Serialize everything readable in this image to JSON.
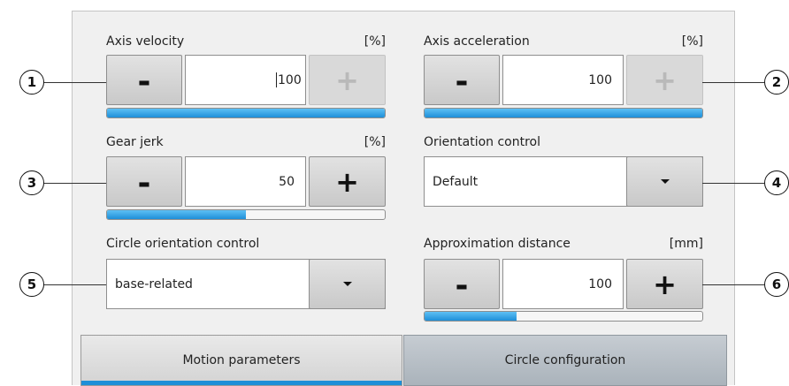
{
  "fields": {
    "axis_velocity": {
      "label": "Axis velocity",
      "unit": "[%]",
      "value": "100",
      "minus": "-",
      "plus": "+",
      "slider_fraction": 1.0
    },
    "axis_acceleration": {
      "label": "Axis acceleration",
      "unit": "[%]",
      "value": "100",
      "minus": "-",
      "plus": "+",
      "slider_fraction": 1.0
    },
    "gear_jerk": {
      "label": "Gear jerk",
      "unit": "[%]",
      "value": "50",
      "minus": "-",
      "plus": "+",
      "slider_fraction": 0.5
    },
    "orientation_control": {
      "label": "Orientation control",
      "selected": "Default"
    },
    "circle_orientation_control": {
      "label": "Circle orientation control",
      "selected": "base-related"
    },
    "approximation_distance": {
      "label": "Approximation distance",
      "unit": "[mm]",
      "value": "100",
      "minus": "-",
      "plus": "+",
      "slider_fraction": 0.33
    }
  },
  "tabs": [
    {
      "label": "Motion parameters",
      "active": true
    },
    {
      "label": "Circle configuration",
      "active": false
    }
  ],
  "callouts": [
    "1",
    "2",
    "3",
    "4",
    "5",
    "6"
  ],
  "colors": {
    "accent": "#1e8fd8",
    "panel": "#f0f0f0",
    "tab_inactive": "#aab3bb"
  }
}
